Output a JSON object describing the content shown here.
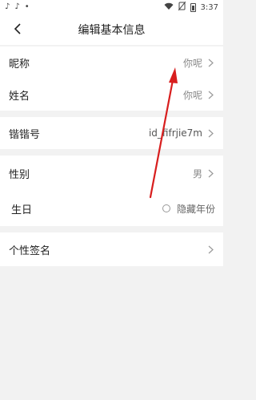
{
  "status": {
    "time": "3:37",
    "left_icons": [
      "tiktok-icon",
      "tiktok-icon",
      "dot-icon"
    ],
    "right_icons": [
      "wifi-icon",
      "no-sim-icon",
      "battery-icon"
    ]
  },
  "header": {
    "title": "编辑基本信息"
  },
  "profile": {
    "nickname_label": "昵称",
    "nickname_value": "你呢",
    "name_label": "姓名",
    "name_value": "你呢",
    "id_label": "锴锴号",
    "id_value": "id_fifrjie7m",
    "gender_label": "性别",
    "gender_value": "男",
    "birthday_label": "生日",
    "birthday_hide_label": "隐藏年份",
    "signature_label": "个性签名"
  },
  "colors": {
    "annotation_arrow": "#d81e1e",
    "background": "#f2f2f2"
  }
}
